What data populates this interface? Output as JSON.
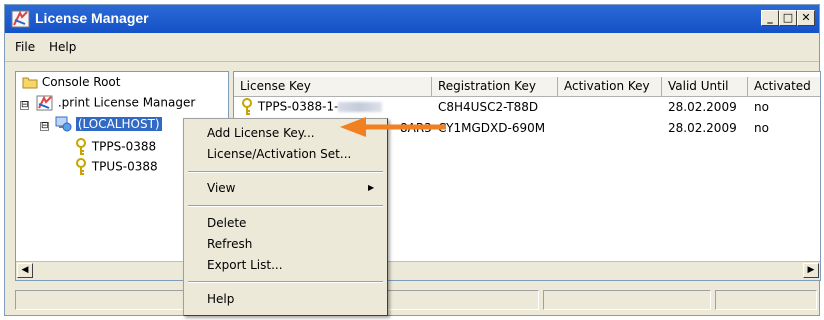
{
  "window": {
    "title": "License Manager",
    "minimize_glyph": "_",
    "maximize_glyph": "□",
    "close_glyph": "✕"
  },
  "menubar": [
    "File",
    "Help"
  ],
  "tree": {
    "root": "Console Root",
    "manager": ".print License Manager",
    "host": "(LOCALHOST)",
    "expander_glyph": "⊟",
    "children": [
      "TPPS-0388",
      "TPUS-0388"
    ]
  },
  "list": {
    "columns": [
      "License Key",
      "Registration Key",
      "Activation Key",
      "Valid Until",
      "Activated"
    ],
    "rows": [
      {
        "license_prefix": "TPPS-0388-1-",
        "license_suffix": "",
        "registration": "C8H4USC2-T88D",
        "activation": "",
        "valid_until": "28.02.2009",
        "activated": "no"
      },
      {
        "license_prefix": "",
        "license_suffix": "8AR3",
        "registration": "CY1MGDXD-690M",
        "activation": "",
        "valid_until": "28.02.2009",
        "activated": "no"
      }
    ]
  },
  "context_menu": {
    "items": [
      "Add License Key...",
      "License/Activation Set...",
      "View",
      "Delete",
      "Refresh",
      "Export List...",
      "Help"
    ],
    "submenu_glyph": "▶"
  },
  "scroll": {
    "left_glyph": "◀",
    "right_glyph": "▶"
  },
  "colors": {
    "titlebar": "#1451c6",
    "selection": "#316ac5",
    "arrow": "#f08020",
    "key_icon": "#c8a400"
  },
  "icons": [
    "app-icon",
    "folder-icon",
    "license-manager-icon",
    "computer-icon",
    "key-icon",
    "arrow-annotation"
  ]
}
